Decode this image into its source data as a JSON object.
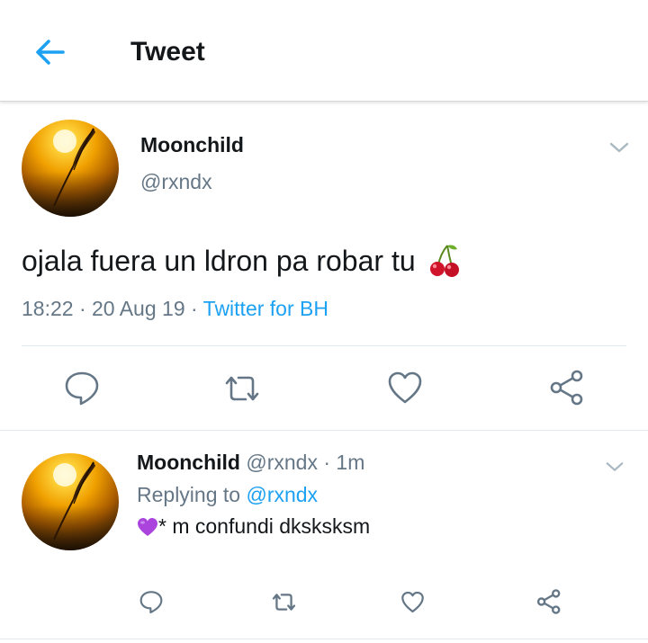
{
  "header": {
    "title": "Tweet",
    "back_icon": "arrow-left-icon",
    "accent": "#1da1f2"
  },
  "tweet": {
    "author_name": "Moonchild",
    "author_handle": "@rxndx",
    "text": "ojala fuera un ldron pa robar tu",
    "emoji": "cherries-emoji",
    "time": "18:22",
    "sep1": "·",
    "date": "20 Aug 19",
    "sep2": "·",
    "source": "Twitter for BH",
    "actions": [
      "reply-icon",
      "retweet-icon",
      "like-icon",
      "share-icon"
    ]
  },
  "reply": {
    "author_name": "Moonchild",
    "author_handle": "@rxndx",
    "dot": "·",
    "time": "1m",
    "replying_label": "Replying to",
    "replying_to": "@rxndx",
    "text": "* m confundi dksksksm",
    "emoji": "purple-heart-emoji",
    "actions": [
      "reply-icon",
      "retweet-icon",
      "like-icon",
      "share-icon"
    ]
  },
  "colors": {
    "text": "#14171a",
    "secondary": "#657786",
    "link": "#1da1f2",
    "divider": "#e1e8ed",
    "icon": "#657786"
  }
}
